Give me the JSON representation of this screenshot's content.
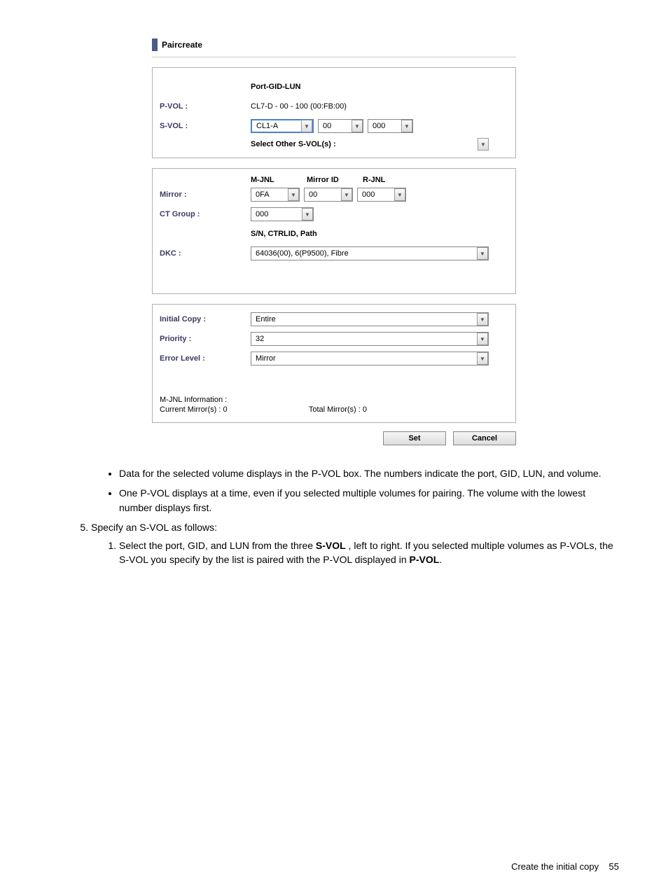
{
  "dialog": {
    "title": "Paircreate",
    "port_gid_lun_header": "Port-GID-LUN",
    "pvol_label": "P-VOL :",
    "pvol_value": "CL7-D - 00 - 100 (00:FB:00)",
    "svol_label": "S-VOL :",
    "svol_port": "CL1-A",
    "svol_gid": "00",
    "svol_lun": "000",
    "select_other_svol": "Select Other S-VOL(s) :",
    "mjnl_header": "M-JNL",
    "mirrorid_header": "Mirror ID",
    "rjnl_header": "R-JNL",
    "mirror_label": "Mirror :",
    "mirror_mjnl": "0FA",
    "mirror_id": "00",
    "mirror_rjnl": "000",
    "ctgroup_label": "CT Group :",
    "ctgroup_value": "000",
    "sn_ctrlid_path": "S/N, CTRLID, Path",
    "dkc_label": "DKC :",
    "dkc_value": "64036(00), 6(P9500), Fibre",
    "initial_copy_label": "Initial Copy :",
    "initial_copy_value": "Entire",
    "priority_label": "Priority :",
    "priority_value": "32",
    "error_level_label": "Error Level :",
    "error_level_value": "Mirror",
    "mjnl_info_label": "M-JNL Information :",
    "current_mirrors": "Current Mirror(s) :   0",
    "total_mirrors": "Total Mirror(s) :   0",
    "set_btn": "Set",
    "cancel_btn": "Cancel"
  },
  "doc": {
    "bullet1": "Data for the selected volume displays in the P-VOL box. The numbers indicate the port, GID, LUN, and volume.",
    "bullet2": "One P-VOL displays at a time, even if you selected multiple volumes for pairing. The volume with the lowest number displays first.",
    "step5": "Specify an S-VOL as follows:",
    "step5_1_a": "Select the port, GID, and LUN from the three ",
    "step5_1_b": "S-VOL",
    "step5_1_c": " , left to right. If you selected multiple volumes as P-VOLs, the S-VOL you specify by the list is paired with the P-VOL displayed in ",
    "step5_1_d": "P-VOL",
    "step5_1_e": ".",
    "footer_text": "Create the initial copy",
    "footer_page": "55"
  }
}
